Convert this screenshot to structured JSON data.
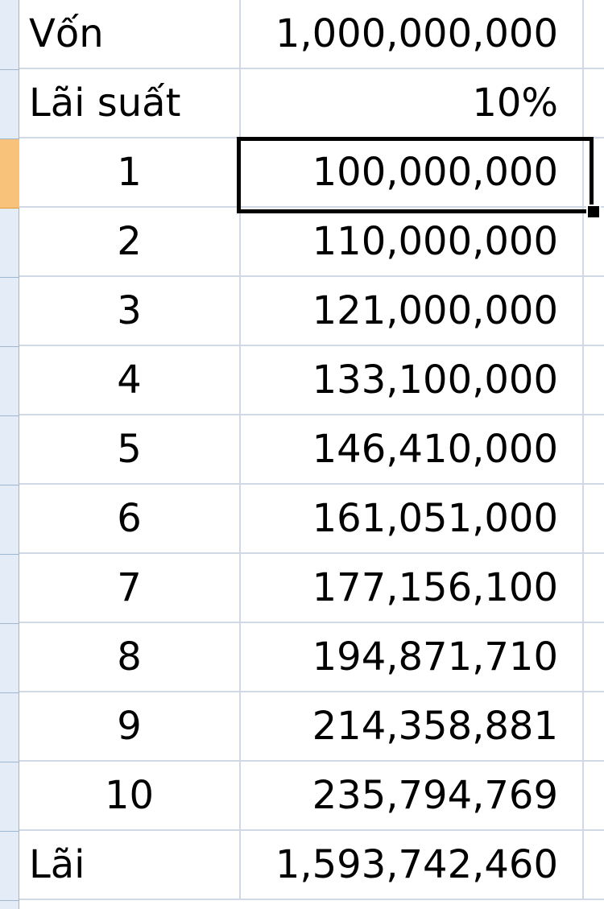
{
  "sheet": {
    "active_row_index": 2,
    "selected_cell_value": "100,000,000",
    "rows": [
      {
        "label": "Vốn",
        "value": "1,000,000,000",
        "label_align": "left"
      },
      {
        "label": "Lãi suất",
        "value": "10%",
        "label_align": "left"
      },
      {
        "label": "1",
        "value": "100,000,000",
        "label_align": "center"
      },
      {
        "label": "2",
        "value": "110,000,000",
        "label_align": "center"
      },
      {
        "label": "3",
        "value": "121,000,000",
        "label_align": "center"
      },
      {
        "label": "4",
        "value": "133,100,000",
        "label_align": "center"
      },
      {
        "label": "5",
        "value": "146,410,000",
        "label_align": "center"
      },
      {
        "label": "6",
        "value": "161,051,000",
        "label_align": "center"
      },
      {
        "label": "7",
        "value": "177,156,100",
        "label_align": "center"
      },
      {
        "label": "8",
        "value": "194,871,710",
        "label_align": "center"
      },
      {
        "label": "9",
        "value": "214,358,881",
        "label_align": "center"
      },
      {
        "label": "10",
        "value": "235,794,769",
        "label_align": "center"
      },
      {
        "label": "Lãi",
        "value": "1,593,742,460",
        "label_align": "left"
      }
    ]
  },
  "colors": {
    "gridline": "#d0d7e5",
    "row_header_bg": "#e4ecf7",
    "row_header_active": "#f8c27a",
    "selection_border": "#000000"
  }
}
